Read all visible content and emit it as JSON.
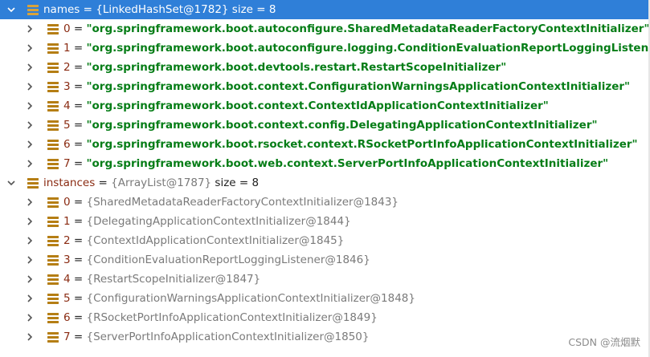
{
  "root_names": {
    "var": "names",
    "eq": " = ",
    "obj": "{LinkedHashSet@1782}",
    "size": "  size = 8",
    "children": [
      {
        "idx": "0",
        "eq": " = ",
        "value": "\"org.springframework.boot.autoconfigure.SharedMetadataReaderFactoryContextInitializer\""
      },
      {
        "idx": "1",
        "eq": " = ",
        "value": "\"org.springframework.boot.autoconfigure.logging.ConditionEvaluationReportLoggingListener\""
      },
      {
        "idx": "2",
        "eq": " = ",
        "value": "\"org.springframework.boot.devtools.restart.RestartScopeInitializer\""
      },
      {
        "idx": "3",
        "eq": " = ",
        "value": "\"org.springframework.boot.context.ConfigurationWarningsApplicationContextInitializer\""
      },
      {
        "idx": "4",
        "eq": " = ",
        "value": "\"org.springframework.boot.context.ContextIdApplicationContextInitializer\""
      },
      {
        "idx": "5",
        "eq": " = ",
        "value": "\"org.springframework.boot.context.config.DelegatingApplicationContextInitializer\""
      },
      {
        "idx": "6",
        "eq": " = ",
        "value": "\"org.springframework.boot.rsocket.context.RSocketPortInfoApplicationContextInitializer\""
      },
      {
        "idx": "7",
        "eq": " = ",
        "value": "\"org.springframework.boot.web.context.ServerPortInfoApplicationContextInitializer\""
      }
    ]
  },
  "root_instances": {
    "var": "instances",
    "eq": " = ",
    "obj": "{ArrayList@1787}",
    "size": "  size = 8",
    "children": [
      {
        "idx": "0",
        "eq": " = ",
        "value": "{SharedMetadataReaderFactoryContextInitializer@1843}"
      },
      {
        "idx": "1",
        "eq": " = ",
        "value": "{DelegatingApplicationContextInitializer@1844}"
      },
      {
        "idx": "2",
        "eq": " = ",
        "value": "{ContextIdApplicationContextInitializer@1845}"
      },
      {
        "idx": "3",
        "eq": " = ",
        "value": "{ConditionEvaluationReportLoggingListener@1846}"
      },
      {
        "idx": "4",
        "eq": " = ",
        "value": "{RestartScopeInitializer@1847}"
      },
      {
        "idx": "5",
        "eq": " = ",
        "value": "{ConfigurationWarningsApplicationContextInitializer@1848}"
      },
      {
        "idx": "6",
        "eq": " = ",
        "value": "{RSocketPortInfoApplicationContextInitializer@1849}"
      },
      {
        "idx": "7",
        "eq": " = ",
        "value": "{ServerPortInfoApplicationContextInitializer@1850}"
      }
    ]
  },
  "watermark": "CSDN @流烟默",
  "icons": {
    "expanded": "chevron-down-icon",
    "collapsed": "chevron-right-icon",
    "field": "field-icon"
  },
  "colors": {
    "selection": "#2f7fd8",
    "string_value": "#067d17",
    "variable_name": "#8a2b12",
    "object_ref": "#7a7a7a",
    "field_icon": "#b57e14"
  }
}
